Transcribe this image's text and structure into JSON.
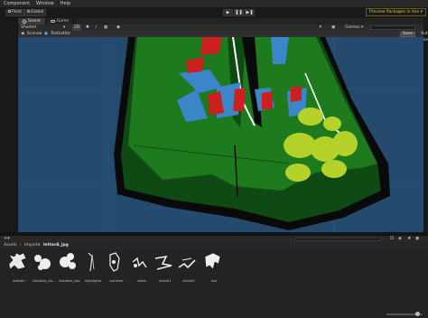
{
  "menu": [
    "Component",
    "Window",
    "Help"
  ],
  "toolbar": {
    "pivot_label": "Pivot",
    "global_label": "Global",
    "preview_packages": "Preview Packages in Use ▾"
  },
  "play_controls": [
    "▶",
    "❚❚",
    "▶❚"
  ],
  "tabs": [
    {
      "icon": "scene-icon",
      "label": "Scene"
    },
    {
      "icon": "game-icon",
      "label": "Game"
    }
  ],
  "scene_toolbar": {
    "shading_mode": "Shaded",
    "mode_2d": "2D",
    "gizmos": "Gizmos ▾",
    "all_search": "All"
  },
  "breadcrumb": {
    "root": "Scenes",
    "current": "TestLetter",
    "save_label": "Save",
    "auto_save_label": "Auto Save"
  },
  "project_breadcrumb": [
    "Assets",
    "Imports",
    "letterA_jpg"
  ],
  "assets": [
    {
      "label": "bottom",
      "icon": "sprite-thumbnail-icon"
    },
    {
      "label": "bubbles_bo...",
      "icon": "sprite-thumbnail-icon"
    },
    {
      "label": "bubbles_top",
      "icon": "sprite-thumbnail-icon"
    },
    {
      "label": "highlights",
      "icon": "sprite-thumbnail-icon"
    },
    {
      "label": "outlines",
      "icon": "sprite-thumbnail-icon"
    },
    {
      "label": "sides",
      "icon": "sprite-thumbnail-icon"
    },
    {
      "label": "stripe1",
      "icon": "sprite-thumbnail-icon"
    },
    {
      "label": "stripe2",
      "icon": "sprite-thumbnail-icon"
    },
    {
      "label": "top",
      "icon": "sprite-thumbnail-icon"
    }
  ],
  "colors": {
    "viewport_bg": "#244a6e",
    "letter_green": "#1d7a1d",
    "letter_dark_green": "#0f4a14",
    "bubble_yellow": "#b5d22a",
    "stripe_red": "#cc1f1f",
    "stripe_blue": "#3a86c8",
    "preview_text": "#e8c93a"
  }
}
